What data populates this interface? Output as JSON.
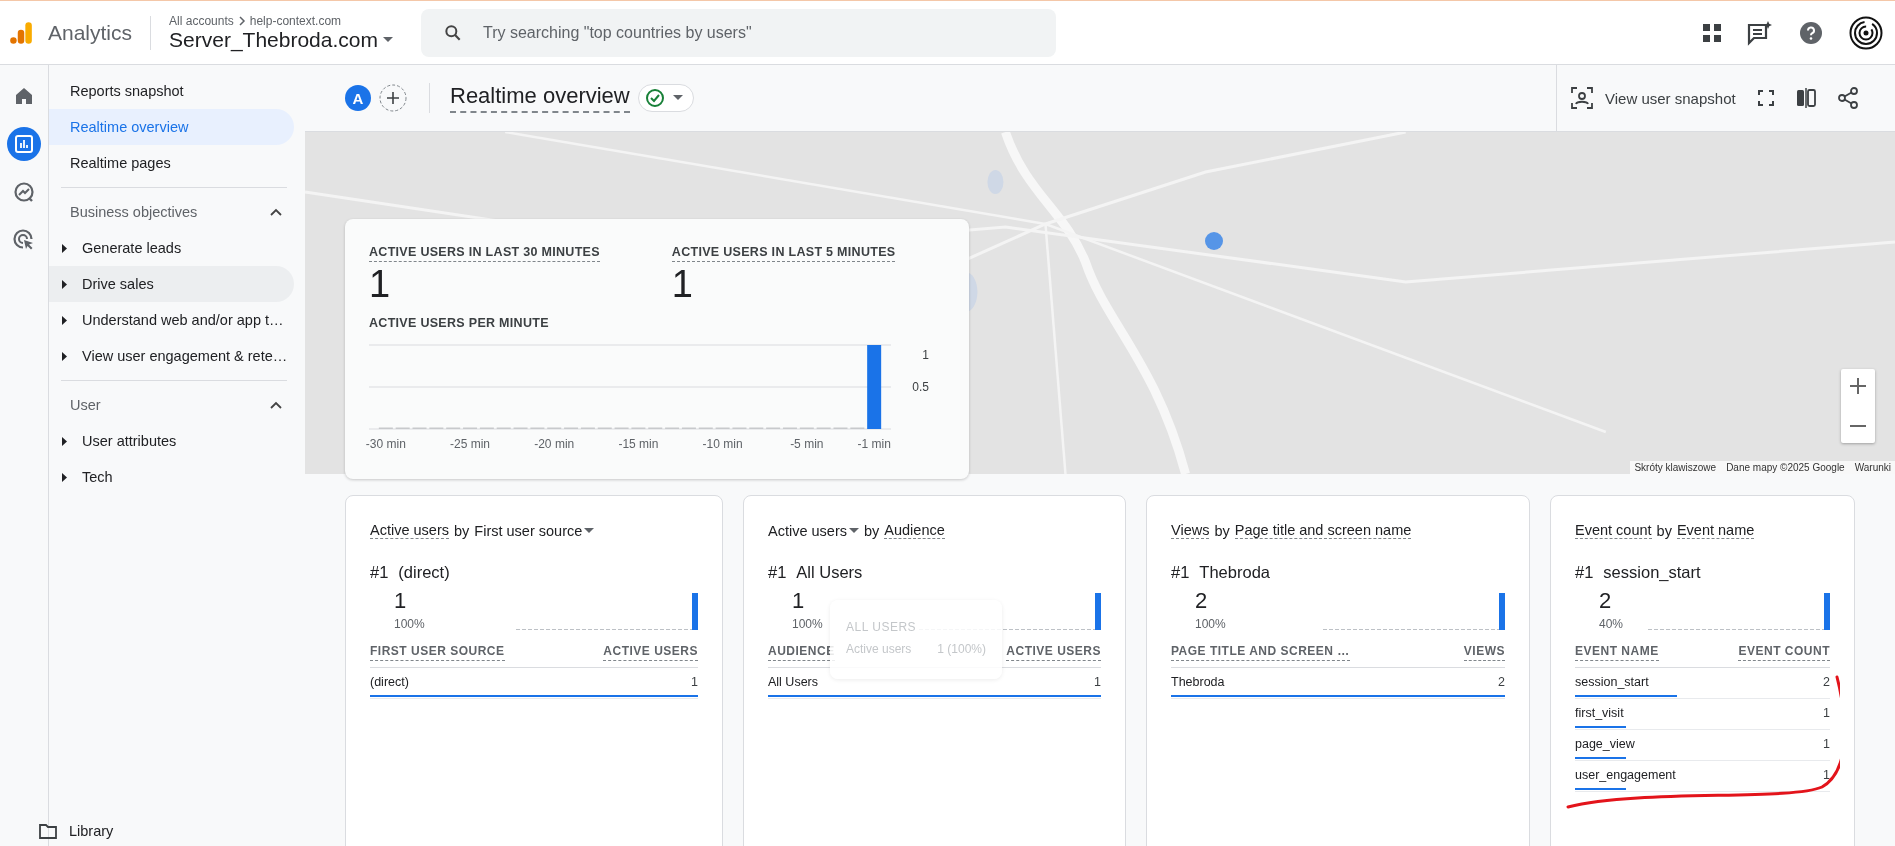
{
  "topbar": {
    "app_name": "Analytics",
    "breadcrumb": [
      "All accounts",
      "help-context.com"
    ],
    "property": "Server_Thebroda.com",
    "search": {
      "placeholder": "Try searching \"top countries by users\""
    }
  },
  "rail": [
    {
      "kind": "home",
      "selected": false
    },
    {
      "kind": "reports",
      "selected": true
    },
    {
      "kind": "explore",
      "selected": false
    },
    {
      "kind": "advertising",
      "selected": false
    }
  ],
  "sidebar": {
    "items": [
      {
        "label": "Reports snapshot",
        "selected": false
      },
      {
        "label": "Realtime overview",
        "selected": true
      },
      {
        "label": "Realtime pages",
        "selected": false
      }
    ],
    "sections": [
      {
        "title": "Business objectives",
        "expanded": true,
        "items": [
          {
            "label": "Generate leads",
            "hovered": false
          },
          {
            "label": "Drive sales",
            "hovered": true
          },
          {
            "label": "Understand web and/or app t…",
            "hovered": false
          },
          {
            "label": "View user engagement & rete…",
            "hovered": false
          }
        ]
      },
      {
        "title": "User",
        "expanded": true,
        "items": [
          {
            "label": "User attributes",
            "hovered": false
          },
          {
            "label": "Tech",
            "hovered": false
          }
        ]
      }
    ],
    "footer": "Library"
  },
  "header": {
    "comparison_badge": "A",
    "title": "Realtime overview",
    "snapshot_button": "View user snapshot"
  },
  "map": {
    "attribution": [
      "Skróty klawiszowe",
      "Dane mapy ©2025 Google",
      "Warunki"
    ]
  },
  "overview_card": {
    "metrics": [
      {
        "label": "ACTIVE USERS IN LAST 30 MINUTES",
        "value": "1"
      },
      {
        "label": "ACTIVE USERS IN LAST 5 MINUTES",
        "value": "1"
      }
    ],
    "chart_title": "ACTIVE USERS PER MINUTE",
    "chart_data": {
      "type": "bar",
      "x": [
        -30,
        -29,
        -28,
        -27,
        -26,
        -25,
        -24,
        -23,
        -22,
        -21,
        -20,
        -19,
        -18,
        -17,
        -16,
        -15,
        -14,
        -13,
        -12,
        -11,
        -10,
        -9,
        -8,
        -7,
        -6,
        -5,
        -4,
        -3,
        -2,
        -1
      ],
      "values": [
        0,
        0,
        0,
        0,
        0,
        0,
        0,
        0,
        0,
        0,
        0,
        0,
        0,
        0,
        0,
        0,
        0,
        0,
        0,
        0,
        0,
        0,
        0,
        0,
        0,
        0,
        0,
        0,
        0,
        1
      ],
      "xticks": [
        {
          "value": -30,
          "label": "-30 min"
        },
        {
          "value": -25,
          "label": "-25 min"
        },
        {
          "value": -20,
          "label": "-20 min"
        },
        {
          "value": -15,
          "label": "-15 min"
        },
        {
          "value": -10,
          "label": "-10 min"
        },
        {
          "value": -5,
          "label": "-5 min"
        },
        {
          "value": -1,
          "label": "-1 min"
        }
      ],
      "xlim": [
        -31,
        0
      ],
      "yticks": [
        0.5,
        1
      ],
      "ylim": [
        0,
        1
      ]
    }
  },
  "cards": [
    {
      "metric": {
        "label": "Active users",
        "dropdown": false
      },
      "joiner": "by",
      "dimension": {
        "label": "First user source",
        "dropdown": true
      },
      "rank": "#1",
      "top_name": "(direct)",
      "top_value": "1",
      "top_share": "100%",
      "columns": [
        "FIRST USER SOURCE",
        "ACTIVE USERS"
      ],
      "rows": [
        {
          "name": "(direct)",
          "value": "1",
          "level": 1
        }
      ]
    },
    {
      "metric": {
        "label": "Active users",
        "dropdown": true
      },
      "joiner": "by",
      "dimension": {
        "label": "Audience",
        "dropdown": false
      },
      "rank": "#1",
      "top_name": "All Users",
      "top_value": "1",
      "top_share": "100%",
      "columns": [
        "AUDIENCE",
        "ACTIVE USERS"
      ],
      "rows": [
        {
          "name": "All Users",
          "value": "1",
          "level": 1
        }
      ],
      "tooltip": {
        "title": "ALL USERS",
        "metric": "Active users",
        "value": "1 (100%)"
      }
    },
    {
      "metric": {
        "label": "Views",
        "dropdown": false
      },
      "joiner": "by",
      "dimension": {
        "label": "Page title and screen name",
        "dropdown": false
      },
      "rank": "#1",
      "top_name": "Thebroda",
      "top_value": "2",
      "top_share": "100%",
      "columns": [
        "PAGE TITLE AND SCREEN …",
        "VIEWS"
      ],
      "rows": [
        {
          "name": "Thebroda",
          "value": "2",
          "level": 1
        }
      ]
    },
    {
      "metric": {
        "label": "Event count",
        "dropdown": false
      },
      "joiner": "by",
      "dimension": {
        "label": "Event name",
        "dropdown": false
      },
      "rank": "#1",
      "top_name": "session_start",
      "top_value": "2",
      "top_share": "40%",
      "columns": [
        "EVENT NAME",
        "EVENT COUNT"
      ],
      "rows": [
        {
          "name": "session_start",
          "value": "2",
          "level": 0.4
        },
        {
          "name": "first_visit",
          "value": "1",
          "level": 0.2
        },
        {
          "name": "page_view",
          "value": "1",
          "level": 0.2
        },
        {
          "name": "user_engagement",
          "value": "1",
          "level": 0.2
        }
      ]
    }
  ]
}
